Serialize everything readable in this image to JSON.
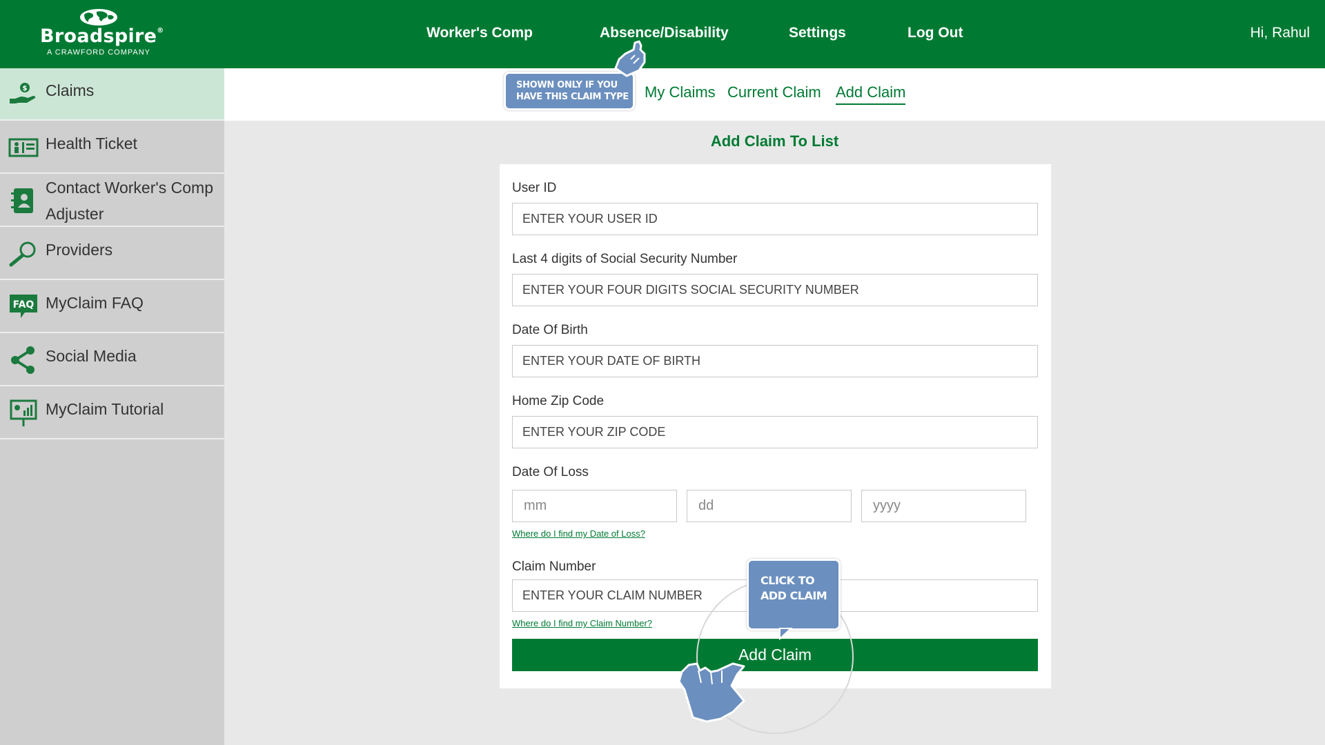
{
  "header": {
    "logo": {
      "name": "Broadspire",
      "registered": "®",
      "tagline": "A CRAWFORD COMPANY"
    },
    "nav": [
      {
        "label": "Worker's Comp"
      },
      {
        "label": "Absence/Disability"
      },
      {
        "label": "Settings"
      },
      {
        "label": "Log Out"
      }
    ],
    "greeting": "Hi, Rahul"
  },
  "sidebar": {
    "items": [
      {
        "label": "Claims",
        "icon": "claims-hand-dollar-icon",
        "active": true
      },
      {
        "label": "Health Ticket",
        "icon": "health-ticket-icon"
      },
      {
        "label": "Contact Worker's Comp",
        "label_line2": "Adjuster",
        "icon": "contact-book-icon"
      },
      {
        "label": "Providers",
        "icon": "magnifier-icon"
      },
      {
        "label": "MyClaim FAQ",
        "icon": "faq-bubble-icon",
        "icon_text": "FAQ"
      },
      {
        "label": "Social Media",
        "icon": "share-icon"
      },
      {
        "label": "MyClaim Tutorial",
        "icon": "presentation-board-icon"
      }
    ]
  },
  "subnav": {
    "links": [
      {
        "label": "My Claims"
      },
      {
        "label": "Current Claim"
      },
      {
        "label": "Add Claim",
        "active": true
      }
    ]
  },
  "main": {
    "title": "Add Claim To List",
    "fields": {
      "user_id": {
        "label": "User ID",
        "placeholder": "ENTER YOUR USER ID",
        "value": ""
      },
      "ssn": {
        "label": "Last 4 digits of Social Security Number",
        "placeholder": "ENTER YOUR FOUR DIGITS SOCIAL SECURITY NUMBER",
        "value": ""
      },
      "dob": {
        "label": "Date Of Birth",
        "placeholder": "ENTER YOUR DATE OF BIRTH",
        "value": ""
      },
      "zip": {
        "label": "Home Zip Code",
        "placeholder": "ENTER YOUR ZIP CODE",
        "value": ""
      },
      "date_of_loss": {
        "label": "Date Of Loss",
        "month_placeholder": "mm",
        "day_placeholder": "dd",
        "year_placeholder": "yyyy",
        "help": "Where do I find my Date of Loss?"
      },
      "claim_number": {
        "label": "Claim Number",
        "placeholder": "ENTER YOUR CLAIM NUMBER",
        "value": "",
        "help": "Where do I find my Claim Number?"
      }
    },
    "submit_label": "Add Claim"
  },
  "tutorial": {
    "callout_absence": {
      "line1": "SHOWN ONLY IF YOU",
      "line2": "HAVE THIS CLAIM TYPE"
    },
    "callout_add": {
      "line1": "CLICK TO",
      "line2": "ADD CLAIM"
    }
  },
  "colors": {
    "brand_green": "#007a33",
    "sidebar_bg": "#cfcfcf",
    "sidebar_active_bg": "#cce6d6",
    "page_bg": "#e8e8e8",
    "callout_blue": "#6b8fbf"
  }
}
